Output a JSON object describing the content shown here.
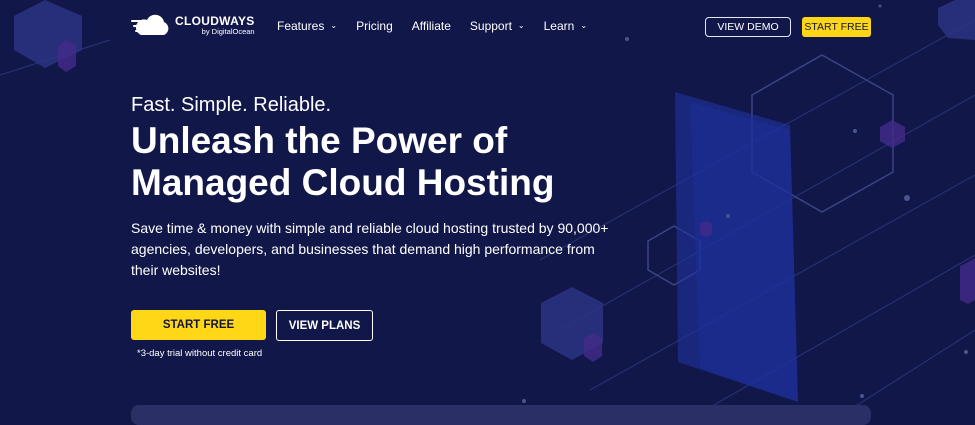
{
  "brand": {
    "name": "CLOUDWAYS",
    "sub": "by DigitalOcean"
  },
  "nav": {
    "items": [
      {
        "label": "Features",
        "has_dropdown": true
      },
      {
        "label": "Pricing",
        "has_dropdown": false
      },
      {
        "label": "Affiliate",
        "has_dropdown": false
      },
      {
        "label": "Support",
        "has_dropdown": true
      },
      {
        "label": "Learn",
        "has_dropdown": true
      }
    ],
    "view_demo": "VIEW DEMO",
    "start_free": "START FREE"
  },
  "hero": {
    "tagline": "Fast. Simple. Reliable.",
    "title_line1": "Unleash the Power of",
    "title_line2": "Managed Cloud Hosting",
    "description": "Save time & money with simple and reliable cloud hosting trusted by 90,000+ agencies, developers, and businesses that demand high performance from their websites!",
    "cta_primary": "START FREE",
    "cta_secondary": "VIEW PLANS",
    "note": "*3-day trial without credit card"
  },
  "colors": {
    "background": "#12174a",
    "accent": "#ffd716",
    "text": "#ffffff",
    "button_text_dark": "#11153f"
  },
  "icons": {
    "logo": "cloud-logo-icon",
    "dropdown": "chevron-down-icon"
  }
}
